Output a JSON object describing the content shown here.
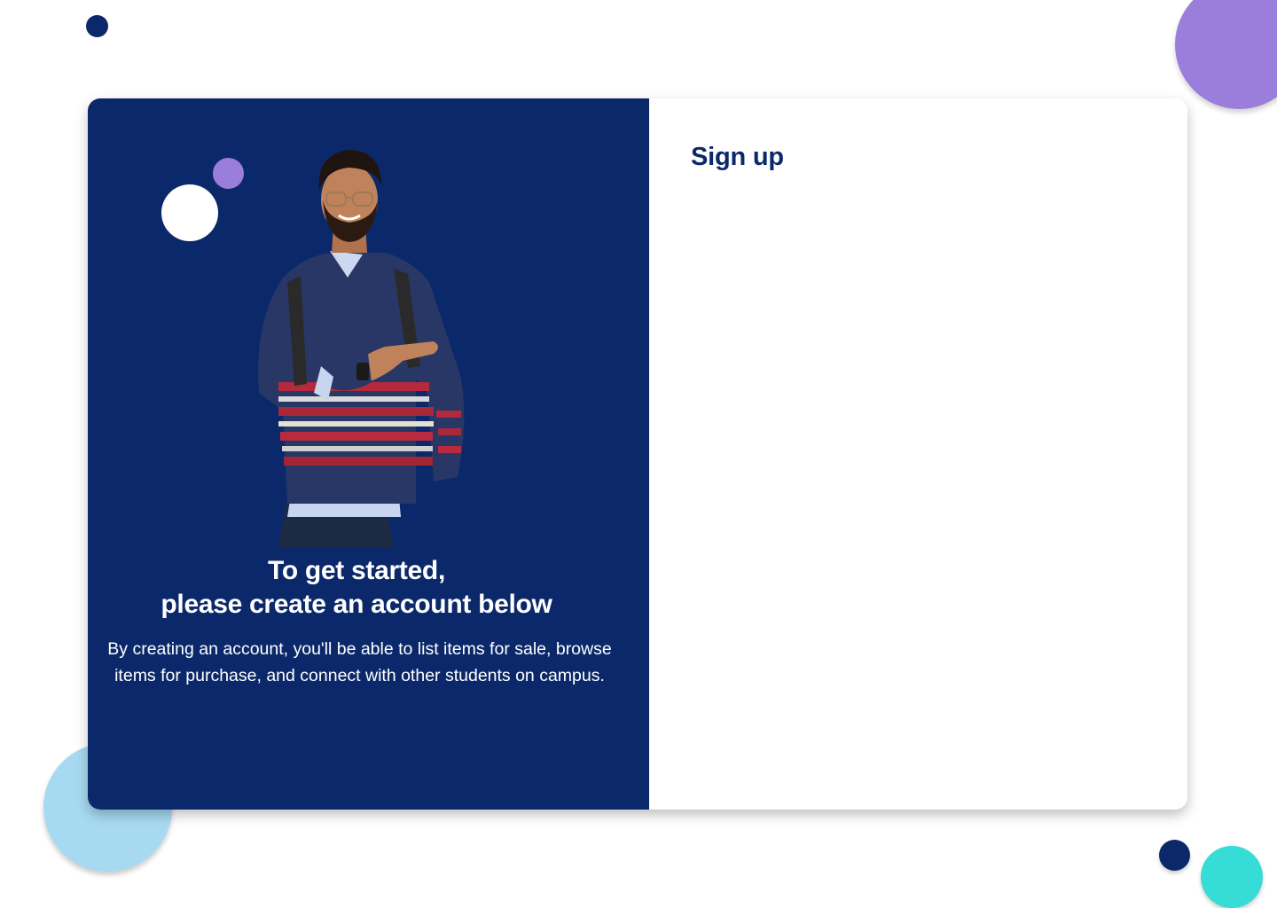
{
  "colors": {
    "navy": "#0b296a",
    "purple": "#9b7ddb",
    "light_blue": "#a7daf1",
    "teal": "#36dcd6",
    "white": "#ffffff"
  },
  "hero": {
    "image": "smiling-student-pointing-icon",
    "headline_line1": "To get started,",
    "headline_line2": "please create an account below",
    "description": "By creating an account, you'll be able to list items for sale, browse items for purchase, and connect with other students on campus."
  },
  "signup": {
    "title": "Sign up"
  }
}
